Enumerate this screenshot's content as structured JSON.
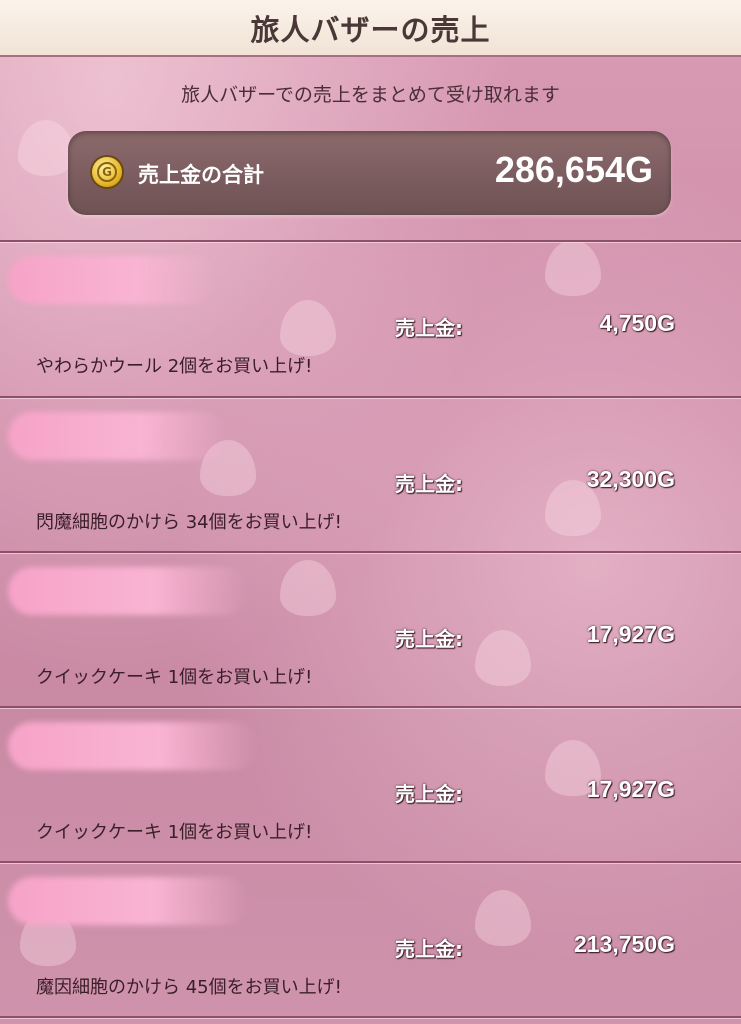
{
  "header": {
    "title": "旅人バザーの売上"
  },
  "subtitle": "旅人バザーでの売上をまとめて受け取れます",
  "total": {
    "coin_icon": "gold-coin-icon",
    "coin_glyph": "G",
    "label": "売上金の合計",
    "value": "286,654G"
  },
  "sales": [
    {
      "label": "売上金:",
      "value": "4,750G",
      "description": "やわらかウール 2個をお買い上げ!"
    },
    {
      "label": "売上金:",
      "value": "32,300G",
      "description": "閃魔細胞のかけら 34個をお買い上げ!"
    },
    {
      "label": "売上金:",
      "value": "17,927G",
      "description": "クイックケーキ 1個をお買い上げ!"
    },
    {
      "label": "売上金:",
      "value": "17,927G",
      "description": "クイックケーキ 1個をお買い上げ!"
    },
    {
      "label": "売上金:",
      "value": "213,750G",
      "description": "魔因細胞のかけら 45個をお買い上げ!"
    }
  ],
  "colors": {
    "background": "#cd8aa6",
    "panel": "#7a5c5e",
    "redacted_name": "#f7a9cc",
    "divider": "#8f4f66"
  }
}
